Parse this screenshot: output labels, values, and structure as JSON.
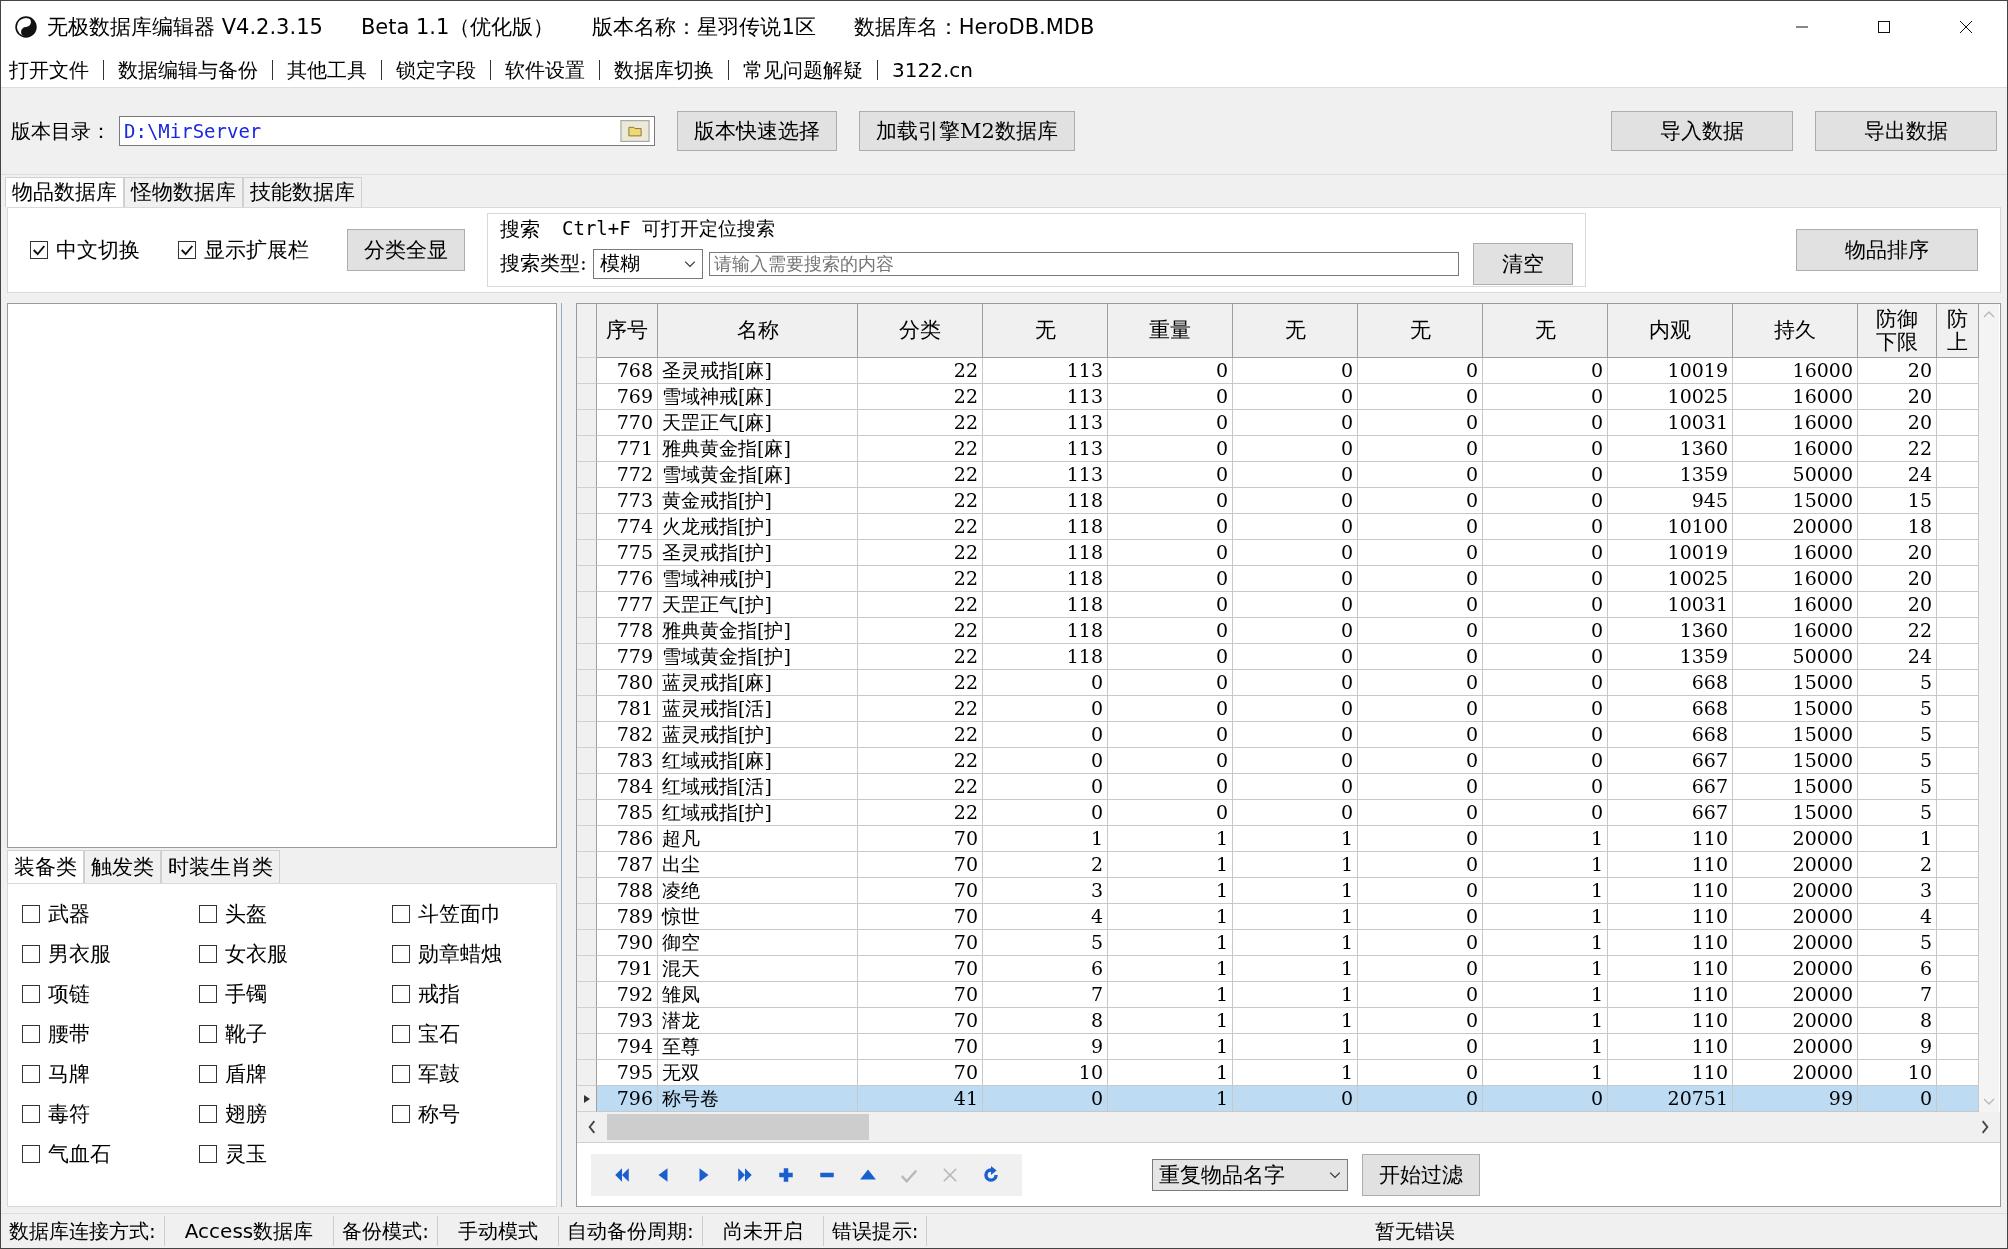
{
  "window": {
    "title_parts": [
      "无极数据库编辑器 V4.2.3.15",
      "Beta 1.1（优化版）",
      "版本名称：星羽传说1区",
      "数据库名：HeroDB.MDB"
    ]
  },
  "menu": [
    "打开文件",
    "数据编辑与备份",
    "其他工具",
    "锁定字段",
    "软件设置",
    "数据库切换",
    "常见问题解疑",
    "3122.cn"
  ],
  "path_row": {
    "label": "版本目录：",
    "value": "D:\\MirServer",
    "buttons": [
      "版本快速选择",
      "加载引擎M2数据库"
    ],
    "right_buttons": [
      "导入数据",
      "导出数据"
    ]
  },
  "db_tabs": [
    {
      "label": "物品数据库",
      "selected": true
    },
    {
      "label": "怪物数据库",
      "selected": false
    },
    {
      "label": "技能数据库",
      "selected": false
    }
  ],
  "filter": {
    "checkboxes": [
      {
        "label": "中文切换",
        "checked": true
      },
      {
        "label": "显示扩展栏",
        "checked": true
      }
    ],
    "show_all_button": "分类全显",
    "search": {
      "title": "搜索",
      "hint": "Ctrl+F 可打开定位搜索",
      "type_label": "搜索类型:",
      "type_value": "模糊",
      "placeholder": "请输入需要搜索的内容",
      "clear_button": "清空"
    },
    "sort_button": "物品排序"
  },
  "category_tabs": [
    {
      "label": "装备类",
      "selected": true
    },
    {
      "label": "触发类",
      "selected": false
    },
    {
      "label": "时装生肖类",
      "selected": false
    }
  ],
  "categories": [
    {
      "label": "武器",
      "checked": false
    },
    {
      "label": "头盔",
      "checked": false
    },
    {
      "label": "斗笠面巾",
      "checked": false
    },
    {
      "label": "男衣服",
      "checked": false
    },
    {
      "label": "女衣服",
      "checked": false
    },
    {
      "label": "勋章蜡烛",
      "checked": false
    },
    {
      "label": "项链",
      "checked": false
    },
    {
      "label": "手镯",
      "checked": false
    },
    {
      "label": "戒指",
      "checked": false
    },
    {
      "label": "腰带",
      "checked": false
    },
    {
      "label": "靴子",
      "checked": false
    },
    {
      "label": "宝石",
      "checked": false
    },
    {
      "label": "马牌",
      "checked": false
    },
    {
      "label": "盾牌",
      "checked": false
    },
    {
      "label": "军鼓",
      "checked": false
    },
    {
      "label": "毒符",
      "checked": false
    },
    {
      "label": "翅膀",
      "checked": false
    },
    {
      "label": "称号",
      "checked": false
    },
    {
      "label": "气血石",
      "checked": false
    },
    {
      "label": "灵玉",
      "checked": false
    }
  ],
  "table": {
    "columns": [
      {
        "lines": [
          "序号"
        ]
      },
      {
        "lines": [
          "名称"
        ]
      },
      {
        "lines": [
          "分类"
        ]
      },
      {
        "lines": [
          "无"
        ]
      },
      {
        "lines": [
          "重量"
        ]
      },
      {
        "lines": [
          "无"
        ]
      },
      {
        "lines": [
          "无"
        ]
      },
      {
        "lines": [
          "无"
        ]
      },
      {
        "lines": [
          "内观"
        ]
      },
      {
        "lines": [
          "持久"
        ]
      },
      {
        "lines": [
          "防御",
          "下限"
        ]
      },
      {
        "lines": [
          "防",
          "上"
        ]
      }
    ],
    "rows": [
      {
        "selected": false,
        "cells": [
          "768",
          "圣灵戒指[麻]",
          "22",
          "113",
          "0",
          "0",
          "0",
          "0",
          "10019",
          "16000",
          "20"
        ]
      },
      {
        "selected": false,
        "cells": [
          "769",
          "雪域神戒[麻]",
          "22",
          "113",
          "0",
          "0",
          "0",
          "0",
          "10025",
          "16000",
          "20"
        ]
      },
      {
        "selected": false,
        "cells": [
          "770",
          "天罡正气[麻]",
          "22",
          "113",
          "0",
          "0",
          "0",
          "0",
          "10031",
          "16000",
          "20"
        ]
      },
      {
        "selected": false,
        "cells": [
          "771",
          "雅典黄金指[麻]",
          "22",
          "113",
          "0",
          "0",
          "0",
          "0",
          "1360",
          "16000",
          "22"
        ]
      },
      {
        "selected": false,
        "cells": [
          "772",
          "雪域黄金指[麻]",
          "22",
          "113",
          "0",
          "0",
          "0",
          "0",
          "1359",
          "50000",
          "24"
        ]
      },
      {
        "selected": false,
        "cells": [
          "773",
          "黄金戒指[护]",
          "22",
          "118",
          "0",
          "0",
          "0",
          "0",
          "945",
          "15000",
          "15"
        ]
      },
      {
        "selected": false,
        "cells": [
          "774",
          "火龙戒指[护]",
          "22",
          "118",
          "0",
          "0",
          "0",
          "0",
          "10100",
          "20000",
          "18"
        ]
      },
      {
        "selected": false,
        "cells": [
          "775",
          "圣灵戒指[护]",
          "22",
          "118",
          "0",
          "0",
          "0",
          "0",
          "10019",
          "16000",
          "20"
        ]
      },
      {
        "selected": false,
        "cells": [
          "776",
          "雪域神戒[护]",
          "22",
          "118",
          "0",
          "0",
          "0",
          "0",
          "10025",
          "16000",
          "20"
        ]
      },
      {
        "selected": false,
        "cells": [
          "777",
          "天罡正气[护]",
          "22",
          "118",
          "0",
          "0",
          "0",
          "0",
          "10031",
          "16000",
          "20"
        ]
      },
      {
        "selected": false,
        "cells": [
          "778",
          "雅典黄金指[护]",
          "22",
          "118",
          "0",
          "0",
          "0",
          "0",
          "1360",
          "16000",
          "22"
        ]
      },
      {
        "selected": false,
        "cells": [
          "779",
          "雪域黄金指[护]",
          "22",
          "118",
          "0",
          "0",
          "0",
          "0",
          "1359",
          "50000",
          "24"
        ]
      },
      {
        "selected": false,
        "cells": [
          "780",
          "蓝灵戒指[麻]",
          "22",
          "0",
          "0",
          "0",
          "0",
          "0",
          "668",
          "15000",
          "5"
        ]
      },
      {
        "selected": false,
        "cells": [
          "781",
          "蓝灵戒指[活]",
          "22",
          "0",
          "0",
          "0",
          "0",
          "0",
          "668",
          "15000",
          "5"
        ]
      },
      {
        "selected": false,
        "cells": [
          "782",
          "蓝灵戒指[护]",
          "22",
          "0",
          "0",
          "0",
          "0",
          "0",
          "668",
          "15000",
          "5"
        ]
      },
      {
        "selected": false,
        "cells": [
          "783",
          "红域戒指[麻]",
          "22",
          "0",
          "0",
          "0",
          "0",
          "0",
          "667",
          "15000",
          "5"
        ]
      },
      {
        "selected": false,
        "cells": [
          "784",
          "红域戒指[活]",
          "22",
          "0",
          "0",
          "0",
          "0",
          "0",
          "667",
          "15000",
          "5"
        ]
      },
      {
        "selected": false,
        "cells": [
          "785",
          "红域戒指[护]",
          "22",
          "0",
          "0",
          "0",
          "0",
          "0",
          "667",
          "15000",
          "5"
        ]
      },
      {
        "selected": false,
        "cells": [
          "786",
          "超凡",
          "70",
          "1",
          "1",
          "1",
          "0",
          "1",
          "110",
          "20000",
          "1"
        ]
      },
      {
        "selected": false,
        "cells": [
          "787",
          "出尘",
          "70",
          "2",
          "1",
          "1",
          "0",
          "1",
          "110",
          "20000",
          "2"
        ]
      },
      {
        "selected": false,
        "cells": [
          "788",
          "凌绝",
          "70",
          "3",
          "1",
          "1",
          "0",
          "1",
          "110",
          "20000",
          "3"
        ]
      },
      {
        "selected": false,
        "cells": [
          "789",
          "惊世",
          "70",
          "4",
          "1",
          "1",
          "0",
          "1",
          "110",
          "20000",
          "4"
        ]
      },
      {
        "selected": false,
        "cells": [
          "790",
          "御空",
          "70",
          "5",
          "1",
          "1",
          "0",
          "1",
          "110",
          "20000",
          "5"
        ]
      },
      {
        "selected": false,
        "cells": [
          "791",
          "混天",
          "70",
          "6",
          "1",
          "1",
          "0",
          "1",
          "110",
          "20000",
          "6"
        ]
      },
      {
        "selected": false,
        "cells": [
          "792",
          "雏凤",
          "70",
          "7",
          "1",
          "1",
          "0",
          "1",
          "110",
          "20000",
          "7"
        ]
      },
      {
        "selected": false,
        "cells": [
          "793",
          "潜龙",
          "70",
          "8",
          "1",
          "1",
          "0",
          "1",
          "110",
          "20000",
          "8"
        ]
      },
      {
        "selected": false,
        "cells": [
          "794",
          "至尊",
          "70",
          "9",
          "1",
          "1",
          "0",
          "1",
          "110",
          "20000",
          "9"
        ]
      },
      {
        "selected": false,
        "cells": [
          "795",
          "无双",
          "70",
          "10",
          "1",
          "1",
          "0",
          "1",
          "110",
          "20000",
          "10"
        ]
      },
      {
        "selected": true,
        "cells": [
          "796",
          "称号卷",
          "41",
          "0",
          "1",
          "0",
          "0",
          "0",
          "20751",
          "99",
          "0"
        ]
      }
    ]
  },
  "navigator": [
    {
      "kind": "first",
      "disabled": false
    },
    {
      "kind": "prior",
      "disabled": false
    },
    {
      "kind": "next",
      "disabled": false
    },
    {
      "kind": "last",
      "disabled": false
    },
    {
      "kind": "insert",
      "disabled": false
    },
    {
      "kind": "delete",
      "disabled": false
    },
    {
      "kind": "edit",
      "disabled": false
    },
    {
      "kind": "post",
      "disabled": true
    },
    {
      "kind": "cancel",
      "disabled": true
    },
    {
      "kind": "refresh",
      "disabled": false
    }
  ],
  "bottom_filter": {
    "value": "重复物品名字",
    "button": "开始过滤"
  },
  "status_bar": [
    "数据库连接方式:",
    "Access数据库",
    "备份模式:",
    "手动模式",
    "自动备份周期:",
    "尚未开启",
    "错误提示:",
    "暂无错误"
  ]
}
